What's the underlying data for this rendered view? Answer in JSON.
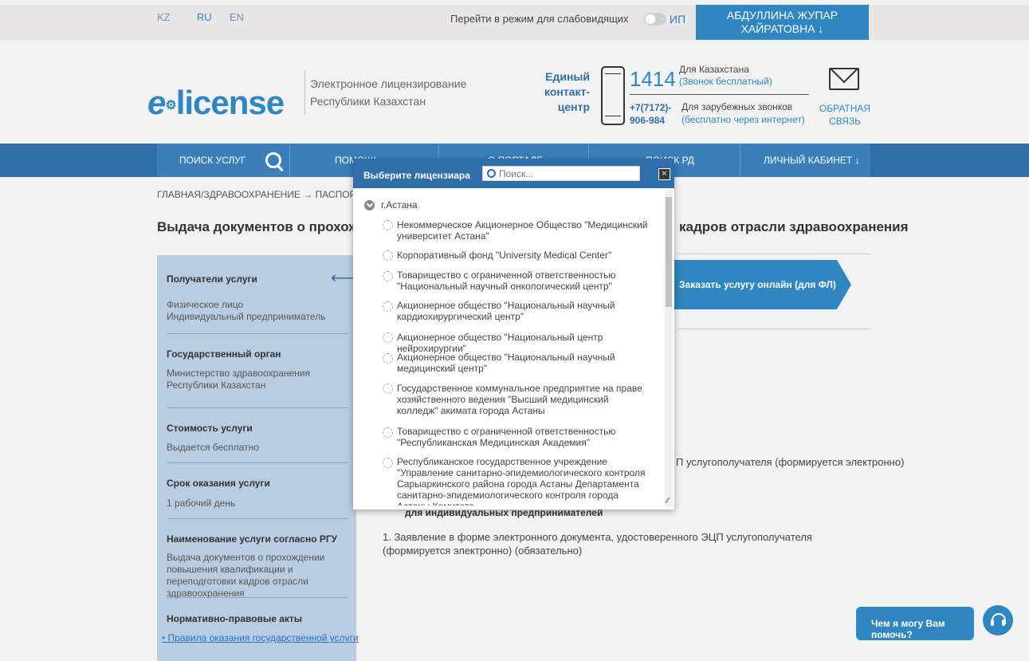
{
  "topbar": {
    "languages": [
      "KZ",
      "RU",
      "EN"
    ],
    "sight_mode": "Перейти в режим для слабовидящих",
    "ip_label": "ИП",
    "user_line1": "АБДУЛЛИНА ЖУПАР",
    "user_line2": "ХАЙРАТОВНА ↓"
  },
  "header": {
    "logo_e": "e",
    "logo_dot": "⚙",
    "logo_rest": "license",
    "tagline_1": "Электронное лицензирование",
    "tagline_2": "Республики Казахстан",
    "contact_1": "Единый",
    "contact_2": "контакт-",
    "contact_3": "центр",
    "phone_short": "1414",
    "phone_kz_label": "Для Казахстана",
    "phone_kz_sub": "(Звонок бесплатный)",
    "phone_long_1": "+7(7172)-",
    "phone_long_2": "906-984",
    "phone_intl_label": "Для зарубежных звонков",
    "phone_intl_sub": "(бесплатно через интернет)",
    "feedback_1": "ОБРАТНАЯ",
    "feedback_2": "СВЯЗЬ"
  },
  "nav": {
    "search": "ПОИСК УСЛУГ",
    "help": "ПОМОЩЬ",
    "portal": "О ПОРТАЛЕ",
    "rd": "ПОИСК РД",
    "cabinet": "ЛИЧНЫЙ КАБИНЕТ ↓"
  },
  "breadcrumb": "ГЛАВНАЯ/ЗДРАВООХРАНЕНИЕ → ПАСПОРТ УСЛ",
  "page_title_left": "Выдача документов о прохождени",
  "page_title_right": "кадров отрасли здравоохранения",
  "sidebar": {
    "recipients_h": "Получатели услуги",
    "recipients_1": "Физическое лицо",
    "recipients_2": "Индивидуальный предприниматель",
    "gov_h": "Государственный орган",
    "gov_t": "Министерство здравоохранения Республики Казахстан",
    "cost_h": "Стоимость услуги",
    "cost_t": "Выдается бесплатно",
    "term_h": "Срок оказания услуги",
    "term_t": "1 рабочий день",
    "name_h": "Наименование услуги согласно РГУ",
    "name_t": "Выдача документов о прохождении повышения квалификации и переподготовки кадров отрасли здравоохранения",
    "npa_h": "Нормативно-правовые акты",
    "npa_link": "Правила оказания государственной услуги"
  },
  "order_button": "Заказать услугу онлайн (для ФЛ)",
  "main": {
    "doc_right": "П услугополучателя (формируется электронно)",
    "indiv_heading": "для индивидуальных предпринимателей",
    "doc_item": "1.  Заявление в форме электронного документа, удостоверенного ЭЦП услугополучателя (формируется электронно) (обязательно)"
  },
  "modal": {
    "title": "Выберите лицензиара",
    "search_placeholder": "Поиск...",
    "close": "×",
    "region": "г.Астана",
    "items": [
      "Некоммерческое Акционерное Общество \"Медицинский университет Астана\"",
      "Корпоративный фонд \"University Medical Center\"",
      "Товарищество с ограниченной ответственностью \"Национальный научный онкологический центр\"",
      "Акционерное общество \"Национальный научный кардиохирургический центр\"",
      "Акционерное общество \"Национальный центр нейрохирургии\"",
      "Акционерное общество \"Национальный научный медицинский центр\"",
      "Государственное коммунальное предприятие на праве хозяйственного ведения \"Высший медицинский колледж\" акимата города Астаны",
      "Товарищество с ограниченной ответственностью \"Республиканская Медицинская Академия\"",
      "Республиканское государственное учреждение \"Управление санитарно-эпидемиологического контроля Сарыаркинского района города Астаны Департамента санитарно-эпидемиологического контроля города Астаны Комитета"
    ]
  },
  "chat": {
    "label": "Чем я могу Вам помочь?"
  },
  "colors": {
    "brand_blue": "#2f86c1",
    "nav_blue": "#2f6ea8",
    "sidebar_bg": "#b9cde2"
  }
}
